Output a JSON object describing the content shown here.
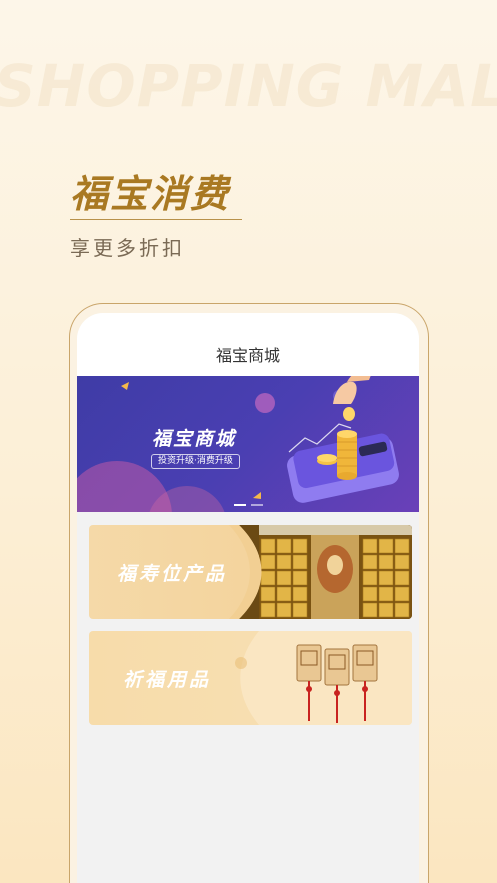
{
  "hero": {
    "watermark": "SHOPPING MALL",
    "headline": "福宝消费",
    "subline": "享更多折扣"
  },
  "app": {
    "title": "福宝商城",
    "banner": {
      "title": "福宝商城",
      "subtitle": "投资升级·消费升级",
      "slide_count": 2,
      "active_slide": 1
    },
    "categories": [
      {
        "label": "福寿位产品"
      },
      {
        "label": "祈福用品"
      }
    ]
  },
  "colors": {
    "accent_gold": "#a97922",
    "banner_purple": "#4a3fb2",
    "card_tan": "#f2cf93"
  }
}
